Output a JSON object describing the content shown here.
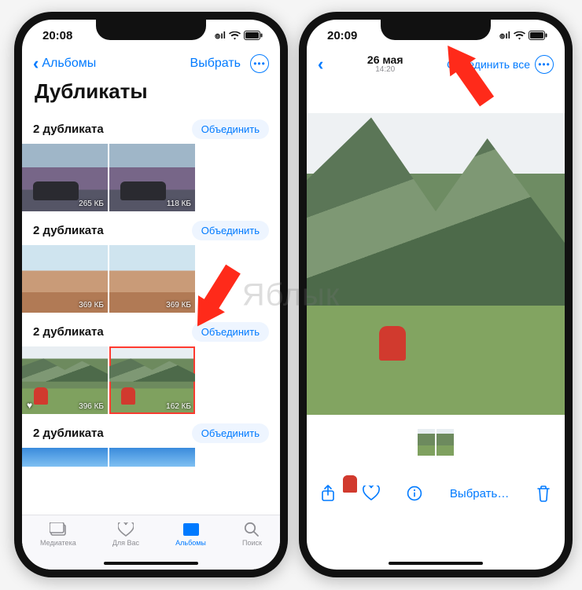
{
  "watermark": "Яблык",
  "left": {
    "status_time": "20:08",
    "nav_back": "Альбомы",
    "nav_select": "Выбрать",
    "title": "Дубликаты",
    "merge_label": "Объединить",
    "groups": [
      {
        "count_label": "2 дубликата",
        "thumbs": [
          {
            "size": "265 КБ",
            "scene": "car-scene"
          },
          {
            "size": "118 КБ",
            "scene": "car-scene"
          }
        ]
      },
      {
        "count_label": "2 дубликата",
        "thumbs": [
          {
            "size": "369 КБ",
            "scene": "town-scene"
          },
          {
            "size": "369 КБ",
            "scene": "town-scene"
          }
        ]
      },
      {
        "count_label": "2 дубликата",
        "thumbs": [
          {
            "size": "396 КБ",
            "scene": "mountain-scene",
            "favorite": true
          },
          {
            "size": "162 КБ",
            "scene": "mountain-scene",
            "selected": true
          }
        ]
      },
      {
        "count_label": "2 дубликата",
        "thumbs": [
          {
            "size": "",
            "scene": "sky-scene"
          },
          {
            "size": "",
            "scene": "sky-scene"
          }
        ]
      }
    ],
    "tabs": [
      {
        "label": "Медиатека",
        "icon": "library-icon"
      },
      {
        "label": "Для Вас",
        "icon": "for-you-icon"
      },
      {
        "label": "Альбомы",
        "icon": "albums-icon",
        "active": true
      },
      {
        "label": "Поиск",
        "icon": "search-icon"
      }
    ]
  },
  "right": {
    "status_time": "20:09",
    "date": "26 мая",
    "time": "14:20",
    "merge_all": "Объединить все",
    "select_label": "Выбрать…",
    "toolbar_icons": [
      "share-icon",
      "heart-icon",
      "info-icon",
      "trash-icon"
    ]
  }
}
